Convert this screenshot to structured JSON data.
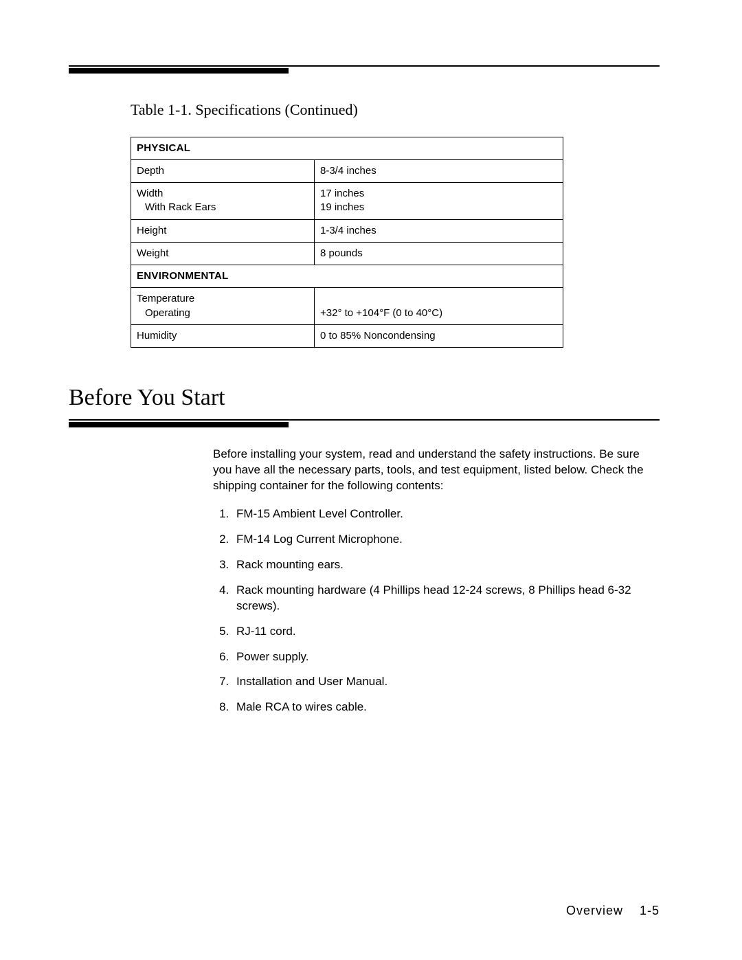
{
  "table": {
    "caption": "Table 1-1. Specifications (Continued)",
    "sections": {
      "physical_header": "PHYSICAL",
      "environmental_header": "ENVIRONMENTAL"
    },
    "rows": {
      "depth_label": "Depth",
      "depth_value": "8-3/4 inches",
      "width_label": "Width",
      "width_sub": "With Rack Ears",
      "width_value": "17 inches",
      "width_value_sub": "19 inches",
      "height_label": "Height",
      "height_value": "1-3/4 inches",
      "weight_label": "Weight",
      "weight_value": "8 pounds",
      "temp_label": "Temperature",
      "temp_sub": "Operating",
      "temp_value": "+32° to +104°F (0 to 40°C)",
      "humidity_label": "Humidity",
      "humidity_value": "0 to 85% Noncondensing"
    }
  },
  "section_heading": "Before You Start",
  "intro_paragraph": "Before installing your system, read and understand the safety instructions. Be sure you have all the necessary parts, tools, and test equipment, listed below. Check the shipping container for the following contents:",
  "checklist": {
    "item1": "FM-15 Ambient Level Controller.",
    "item2": "FM-14 Log Current Microphone.",
    "item3": "Rack mounting ears.",
    "item4": "Rack mounting hardware (4 Phillips head 12-24 screws, 8 Phillips head 6-32 screws).",
    "item5": "RJ-11 cord.",
    "item6": "Power supply.",
    "item7": "Installation and User Manual.",
    "item8": "Male RCA to wires cable."
  },
  "footer": {
    "label": "Overview",
    "page": "1-5"
  }
}
